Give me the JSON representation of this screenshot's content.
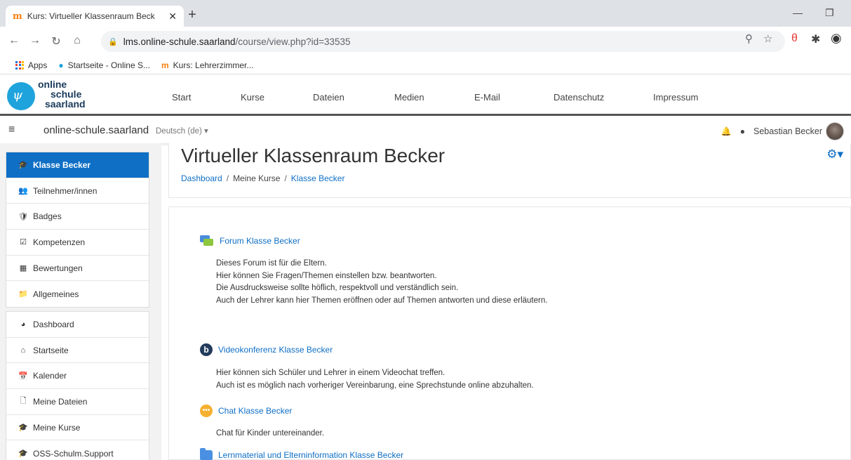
{
  "browser": {
    "tab_title": "Kurs: Virtueller Klassenraum Beck",
    "url_host": "lms.online-schule.saarland",
    "url_path": "/course/view.php?id=33535",
    "bookmarks": [
      "Apps",
      "Startseite - Online S...",
      "Kurs: Lehrerzimmer..."
    ]
  },
  "site": {
    "logo": [
      "online",
      "schule",
      "saarland"
    ],
    "nav": [
      "Start",
      "Kurse",
      "Dateien",
      "Medien",
      "E-Mail",
      "Datenschutz",
      "Impressum"
    ]
  },
  "navbar": {
    "site_name": "online-schule.saarland",
    "language": "Deutsch (de)",
    "user_name": "Sebastian Becker"
  },
  "drawer": {
    "course_items": [
      {
        "label": "Klasse Becker",
        "icon": "graduation-cap-icon"
      },
      {
        "label": "Teilnehmer/innen",
        "icon": "users-icon"
      },
      {
        "label": "Badges",
        "icon": "shield-icon"
      },
      {
        "label": "Kompetenzen",
        "icon": "checkbox-icon"
      },
      {
        "label": "Bewertungen",
        "icon": "table-icon"
      },
      {
        "label": "Allgemeines",
        "icon": "folder-icon"
      }
    ],
    "site_items": [
      {
        "label": "Dashboard",
        "icon": "dashboard-icon"
      },
      {
        "label": "Startseite",
        "icon": "home-icon"
      },
      {
        "label": "Kalender",
        "icon": "calendar-icon"
      },
      {
        "label": "Meine Dateien",
        "icon": "file-icon"
      },
      {
        "label": "Meine Kurse",
        "icon": "graduation-cap-icon"
      },
      {
        "label": "OSS-Schulm.Support",
        "icon": "graduation-cap-icon"
      }
    ]
  },
  "page": {
    "title": "Virtueller Klassenraum Becker",
    "breadcrumb": [
      "Dashboard",
      "Meine Kurse",
      "Klasse Becker"
    ]
  },
  "activities": {
    "forum": {
      "name": "Forum Klasse Becker",
      "lines": [
        "Dieses Forum ist für die Eltern.",
        "Hier können Sie Fragen/Themen einstellen bzw. beantworten.",
        "Die Ausdrucksweise sollte höflich, respektvoll und verständlich sein.",
        "Auch der Lehrer kann hier Themen eröffnen oder auf Themen antworten und diese erläutern."
      ]
    },
    "video": {
      "name": "Videokonferenz Klasse Becker",
      "lines": [
        "Hier können sich Schüler und Lehrer in einem Videochat treffen.",
        "Auch ist es möglich nach vorheriger Vereinbarung, eine Sprechstunde online abzuhalten."
      ]
    },
    "chat": {
      "name": "Chat Klasse Becker",
      "lines": [
        "Chat für Kinder untereinander."
      ]
    },
    "folder": {
      "name": "Lernmaterial und Elterninformation Klasse Becker"
    }
  }
}
